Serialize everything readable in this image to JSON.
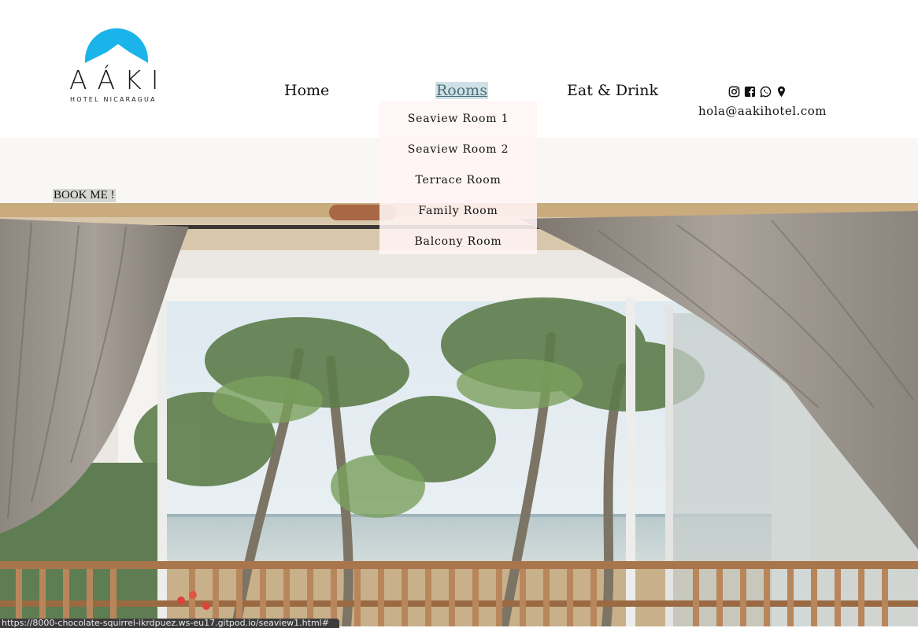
{
  "brand": {
    "name": "AÁKI",
    "tagline": "HOTEL NICARAGUA",
    "color": "#1ab4ea"
  },
  "nav": {
    "home": "Home",
    "rooms": "Rooms",
    "eat_drink": "Eat & Drink"
  },
  "rooms_menu": [
    "Seaview Room 1",
    "Seaview Room 2",
    "Terrace Room",
    "Family Room",
    "Balcony Room"
  ],
  "social_icons": [
    "instagram-icon",
    "facebook-icon",
    "whatsapp-icon",
    "map-pin-icon"
  ],
  "contact": {
    "email": "hola@aakihotel.com"
  },
  "booking": {
    "button_label": "BOOK ME !"
  },
  "status_bar": {
    "url": "https://8000-chocolate-squirrel-ikrdpuez.ws-eu17.gitpod.io/seaview1.html#"
  },
  "colors": {
    "rooms_highlight": "#cfe1e6",
    "book_button_bg": "#d6d6d3",
    "dropdown_bg": "#fff5f5"
  }
}
